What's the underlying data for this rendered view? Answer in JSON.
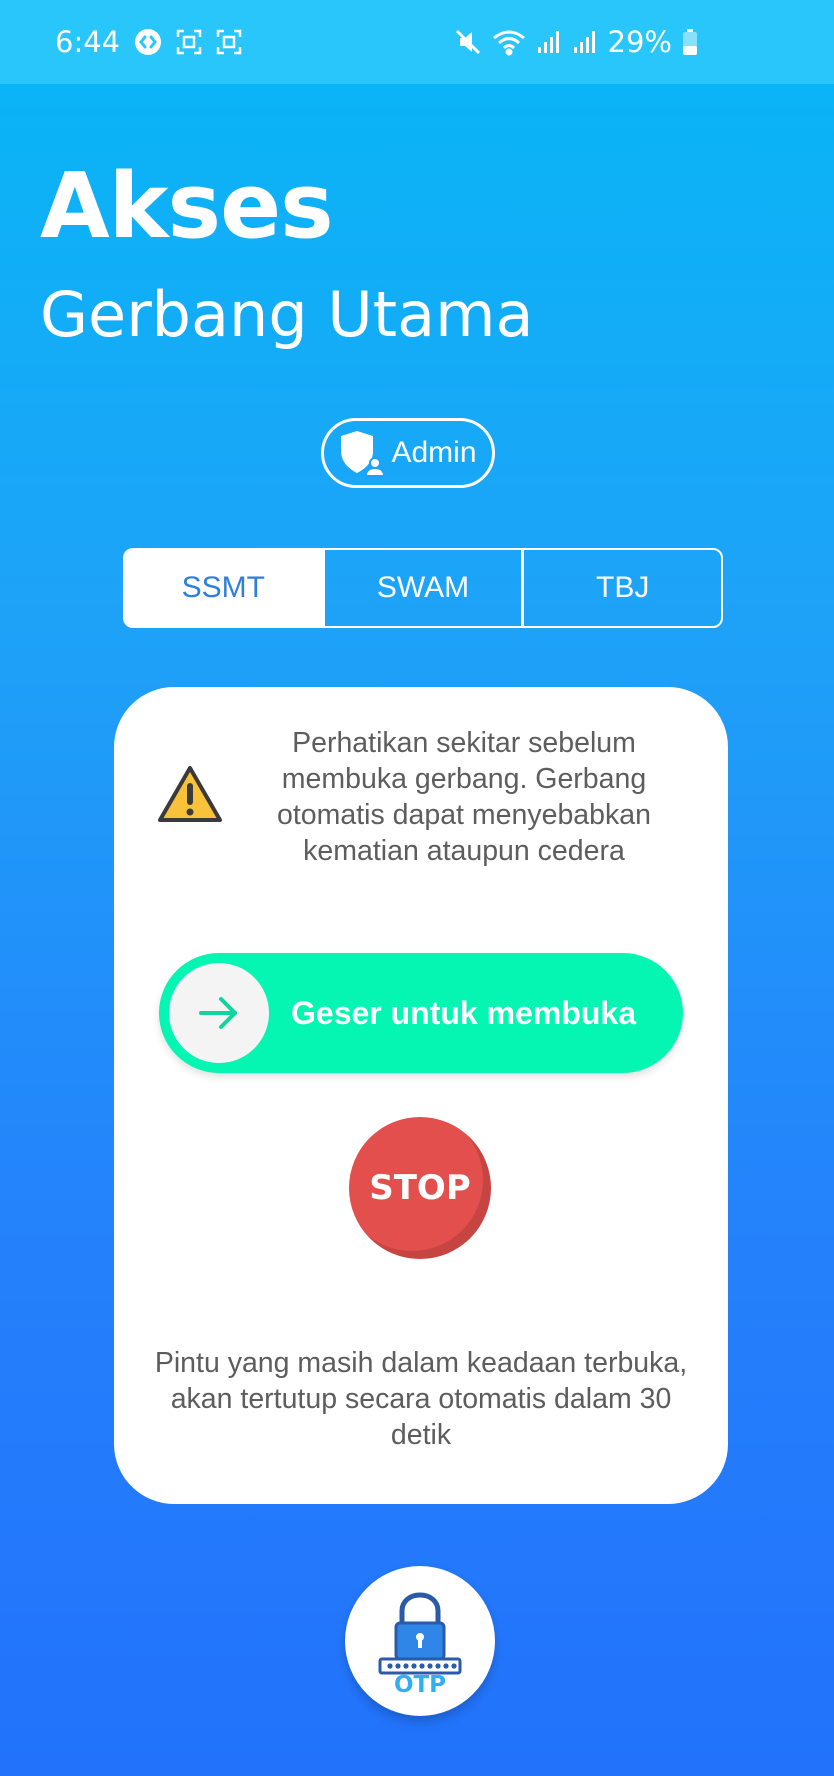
{
  "status_bar": {
    "time": "6:44",
    "battery_percent": "29%",
    "icons": [
      "shazam-icon",
      "screenshot-icon",
      "screenshot-icon",
      "mute-icon",
      "wifi-icon",
      "signal-icon",
      "signal-icon",
      "battery-icon"
    ]
  },
  "header": {
    "title": "Akses",
    "subtitle": "Gerbang Utama"
  },
  "role_badge": {
    "label": "Admin",
    "icon": "shield-user-icon"
  },
  "tabs": [
    {
      "label": "SSMT",
      "active": true
    },
    {
      "label": "SWAM",
      "active": false
    },
    {
      "label": "TBJ",
      "active": false
    }
  ],
  "card": {
    "warning_text": "Perhatikan sekitar sebelum membuka gerbang. Gerbang otomatis dapat menyebabkan kematian ataupun cedera",
    "slider_label": "Geser untuk membuka",
    "stop_label": "STOP",
    "auto_close_text": "Pintu yang masih dalam keadaan terbuka, akan tertutup secara otomatis dalam 30 detik"
  },
  "otp_button": {
    "label": "OTP",
    "icon": "padlock-icon"
  },
  "colors": {
    "accent_blue": "#2f7fdc",
    "slider_green": "#05f5b2",
    "stop_red": "#e24f4c"
  }
}
